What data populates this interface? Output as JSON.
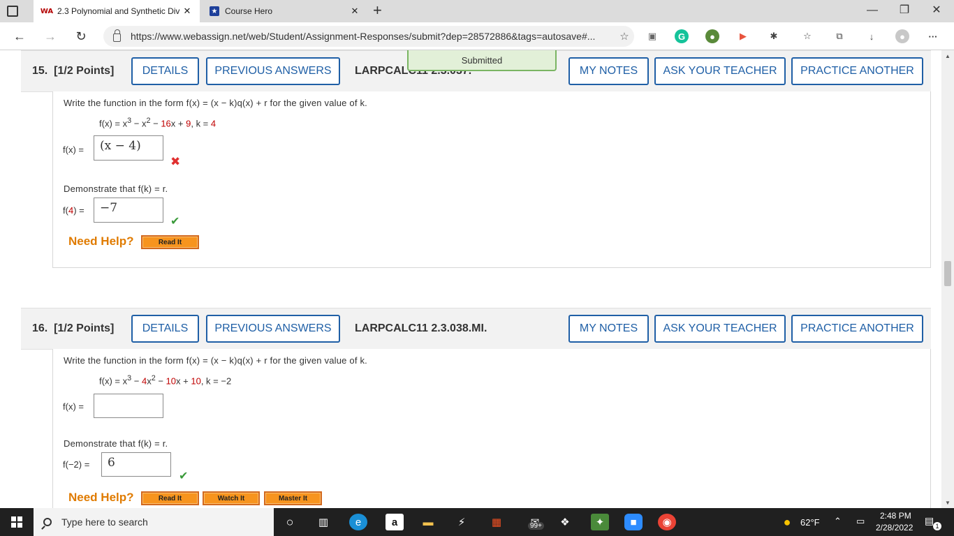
{
  "browser": {
    "tabs": [
      {
        "favicon": "WA",
        "title": "2.3 Polynomial and Synthetic Div",
        "close": "✕"
      },
      {
        "favicon": "★",
        "title": "Course Hero",
        "close": "✕"
      }
    ],
    "new_tab": "+",
    "window_controls": {
      "minimize": "—",
      "restore": "❐",
      "close": "✕"
    },
    "url": "https://www.webassign.net/web/Student/Assignment-Responses/submit?dep=28572886&tags=autosave#...",
    "back": "←",
    "forward": "→",
    "reload": "↻",
    "more": "···"
  },
  "banner": {
    "text": "Submitted"
  },
  "header_buttons": {
    "details": "DETAILS",
    "previous": "PREVIOUS ANSWERS",
    "notes": "MY NOTES",
    "ask": "ASK YOUR TEACHER",
    "practice": "PRACTICE ANOTHER"
  },
  "questions": [
    {
      "number": "15.",
      "points": "[1/2 Points]",
      "code": "LARPCALC11 2.3.037.",
      "prompt": "Write the function in the form f(x) = (x − k)q(x) + r for the given value of k.",
      "equation_parts": [
        "f(x) = x",
        "3",
        " − x",
        "2",
        " − ",
        "16",
        "x + ",
        "9",
        ",  k = ",
        "4"
      ],
      "answer_label": "f(x) =",
      "answer_value": "(x − 4)",
      "demo_prompt": "Demonstrate that f(k) = r.",
      "demo_label_pre": "f(",
      "demo_label_k": "4",
      "demo_label_post": ") =",
      "demo_value": "−7",
      "help_label": "Need Help?",
      "help_buttons": [
        "Read It"
      ]
    },
    {
      "number": "16.",
      "points": "[1/2 Points]",
      "code": "LARPCALC11 2.3.038.MI.",
      "prompt": "Write the function in the form f(x) = (x − k)q(x) + r for the given value of k.",
      "equation_parts": [
        "f(x) = x",
        "3",
        " − ",
        "4",
        "x",
        "2",
        " − ",
        "10",
        "x + ",
        "10",
        ",  k = ",
        "−2"
      ],
      "answer_label": "f(x) =",
      "answer_value": "",
      "demo_prompt": "Demonstrate that f(k) = r.",
      "demo_label": "f(−2) =",
      "demo_value": "6",
      "help_label": "Need Help?",
      "help_buttons": [
        "Read It",
        "Watch It",
        "Master It"
      ]
    }
  ],
  "taskbar": {
    "search_placeholder": "Type here to search",
    "badge": "99+",
    "weather": "62°F",
    "time": "2:48 PM",
    "date": "2/28/2022",
    "notifications": "1"
  },
  "colors": {
    "accent_blue": "#1f5fa6",
    "help_orange": "#e07b00",
    "error_red": "#e03030",
    "success_green": "#3a9a3a"
  }
}
